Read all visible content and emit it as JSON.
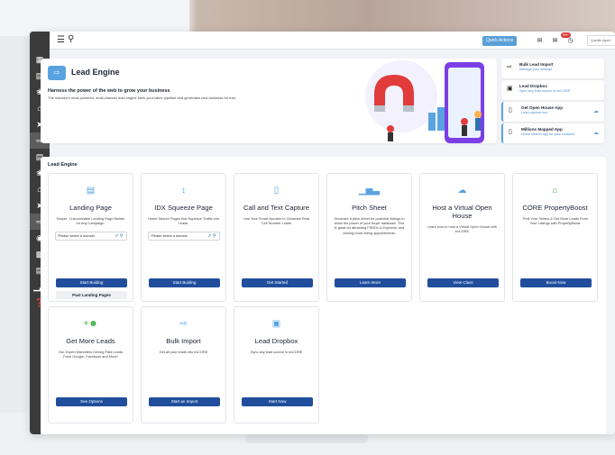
{
  "topbar": {
    "quick_actions": "Quick Actions",
    "notification_count": "99+",
    "user_label": "Quentin Agent"
  },
  "sidebar": {
    "items": [
      "dashboard-icon",
      "contacts-icon",
      "network-icon",
      "home-icon",
      "send-icon",
      "lead-engine-icon",
      "contacts-icon",
      "network-icon",
      "home-icon",
      "send-icon",
      "lead-engine-icon",
      "eye-icon",
      "printer-icon",
      "calendar-icon",
      "bar-chart-icon",
      "help-icon"
    ],
    "active_indices": [
      5,
      10
    ]
  },
  "hero": {
    "title": "Lead Engine",
    "headline": "Harness the power of the web to grow your business",
    "subtitle": "The industry's most powerful, multi-channel lead engine fuels your sales pipeline and generates new business for free."
  },
  "quick_links": [
    {
      "title": "Bulk Lead Import",
      "subtitle": "Manage your settings",
      "icon": "import-icon",
      "accent": false,
      "cloud": false
    },
    {
      "title": "Lead Dropbox",
      "subtitle": "Sync any lead source to kvCORE",
      "icon": "dropbox-icon",
      "accent": false,
      "cloud": false
    },
    {
      "title": "Get Open House App",
      "subtitle": "Lead capture tool",
      "icon": "tablet-icon",
      "accent": true,
      "cloud": true
    },
    {
      "title": "Millions Mapped App",
      "subtitle": "Home search app for your contacts",
      "icon": "tablet-icon",
      "accent": true,
      "cloud": true
    }
  ],
  "section": {
    "title": "Lead Engine"
  },
  "cards": [
    {
      "title": "Landing Page",
      "desc": "Simple, Customizable Landing Page Builder for Any Campaign.",
      "select": "Please select a domain",
      "button": "Start Buiding",
      "button2": "Past Landing Pages",
      "icon": "landing-page-icon"
    },
    {
      "title": "IDX Squeeze Page",
      "desc": "Home Search Pages that Squeeze Traffic into Leads.",
      "select": "Please select a domain",
      "button": "Start Buiding",
      "icon": "squeeze-icon"
    },
    {
      "title": "Call and Text Capture",
      "desc": "Use Your Smart Number to Generate Real Cell Number Leads",
      "button": "Get Started",
      "icon": "phone-icon"
    },
    {
      "title": "Pitch Sheet",
      "desc": "Generate a pitch sheet for potential listings to show the power of your buyer database. This is great for attracting FSBOs & Expireds, and closing more listing appointments.",
      "button": "Learn More",
      "icon": "bar-chart-icon"
    },
    {
      "title": "Host a Virtual Open House",
      "desc": "Learn how to host a Virtual Open House with kvCORE",
      "button": "View Class",
      "icon": "cloud-icon"
    },
    {
      "title": "CORE PropertyBoost",
      "desc": "Thrill Your Sellers & Get More Leads From Your Listings with PropertyBoost",
      "button": "Boost Now",
      "icon": "property-boost-icon"
    },
    {
      "title": "Get More Leads",
      "desc": "Our Expert Marketers Driving Paid Leads From Google, Facebook and More!",
      "button": "See Options",
      "icon": "people-add-icon"
    },
    {
      "title": "Bulk Import",
      "desc": "Get all your leads into kvCORE",
      "button": "Start an Import",
      "icon": "import-icon"
    },
    {
      "title": "Lead Dropbox",
      "desc": "Sync any lead source in kvCORE",
      "button": "Start Now",
      "icon": "dropbox-icon"
    }
  ],
  "colors": {
    "primary_button": "#214e9c",
    "accent_blue": "#5aa3e0",
    "sidebar": "#3b3b3b",
    "badge": "#d93a3a",
    "green_icon": "#3fae3f"
  }
}
